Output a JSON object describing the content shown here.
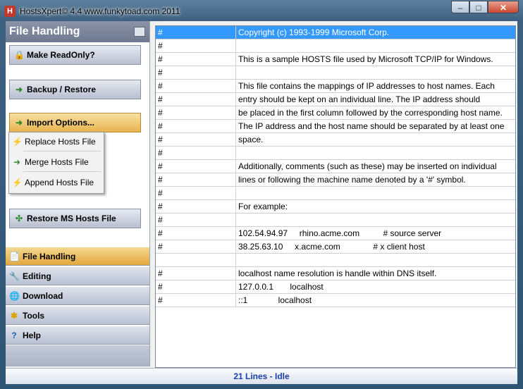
{
  "window": {
    "title": "HostsXpert© 4.4  www.funkytoad.com 2011",
    "app_icon": "H",
    "minimize": "–",
    "maximize": "□",
    "close": "✕"
  },
  "left_panel": {
    "header": "File Handling",
    "actions": [
      {
        "label": "Make ReadOnly?",
        "icon": "lock-icon",
        "glyph": "🔒"
      },
      {
        "label": "Backup / Restore",
        "icon": "arrow-right-icon",
        "glyph": "➜"
      },
      {
        "label": "Import Options...",
        "icon": "arrow-right-icon",
        "glyph": "➜"
      },
      {
        "label": "Restore MS Hosts File",
        "icon": "recycle-icon",
        "glyph": "✣"
      }
    ],
    "import_menu": [
      {
        "label": "Replace Hosts File",
        "icon": "replace-icon",
        "glyph": "⚡"
      },
      {
        "label": "Merge Hosts File",
        "icon": "merge-icon",
        "glyph": "➜"
      },
      {
        "label": "Append Hosts File",
        "icon": "append-icon",
        "glyph": "⚡"
      }
    ],
    "nav": [
      {
        "label": "File Handling",
        "icon": "file-icon",
        "glyph": "📄"
      },
      {
        "label": "Editing",
        "icon": "wrench-icon",
        "glyph": "🔧"
      },
      {
        "label": "Download",
        "icon": "globe-icon",
        "glyph": "🌐"
      },
      {
        "label": "Tools",
        "icon": "tools-icon",
        "glyph": "✱"
      },
      {
        "label": "Help",
        "icon": "help-icon",
        "glyph": "?"
      }
    ]
  },
  "grid": {
    "rows": [
      {
        "c1": "#",
        "c2": "Copyright (c) 1993-1999 Microsoft Corp.",
        "selected": true
      },
      {
        "c1": "#",
        "c2": ""
      },
      {
        "c1": "#",
        "c2": "This is a sample HOSTS file used by Microsoft TCP/IP for Windows."
      },
      {
        "c1": "#",
        "c2": ""
      },
      {
        "c1": "#",
        "c2": "This file contains the mappings of IP addresses to host names. Each"
      },
      {
        "c1": "#",
        "c2": "entry should be kept on an individual line. The IP address should"
      },
      {
        "c1": "#",
        "c2": "be placed in the first column followed by the corresponding host name."
      },
      {
        "c1": "#",
        "c2": "The IP address and the host name should be separated by at least one"
      },
      {
        "c1": "#",
        "c2": "space."
      },
      {
        "c1": "#",
        "c2": ""
      },
      {
        "c1": "#",
        "c2": "Additionally, comments (such as these) may be inserted on individual"
      },
      {
        "c1": "#",
        "c2": "lines or following the machine name denoted by a '#' symbol."
      },
      {
        "c1": "#",
        "c2": ""
      },
      {
        "c1": "#",
        "c2": "For example:"
      },
      {
        "c1": "#",
        "c2": ""
      },
      {
        "c1": "#",
        "c2": "102.54.94.97     rhino.acme.com          # source server"
      },
      {
        "c1": "#",
        "c2": "38.25.63.10     x.acme.com              # x client host"
      },
      {
        "c1": "",
        "c2": ""
      },
      {
        "c1": "#",
        "c2": "localhost name resolution is handle within DNS itself."
      },
      {
        "c1": "#",
        "c2": "127.0.0.1       localhost"
      },
      {
        "c1": "#",
        "c2": "::1             localhost"
      }
    ]
  },
  "status": {
    "text": "21 Lines - Idle"
  }
}
